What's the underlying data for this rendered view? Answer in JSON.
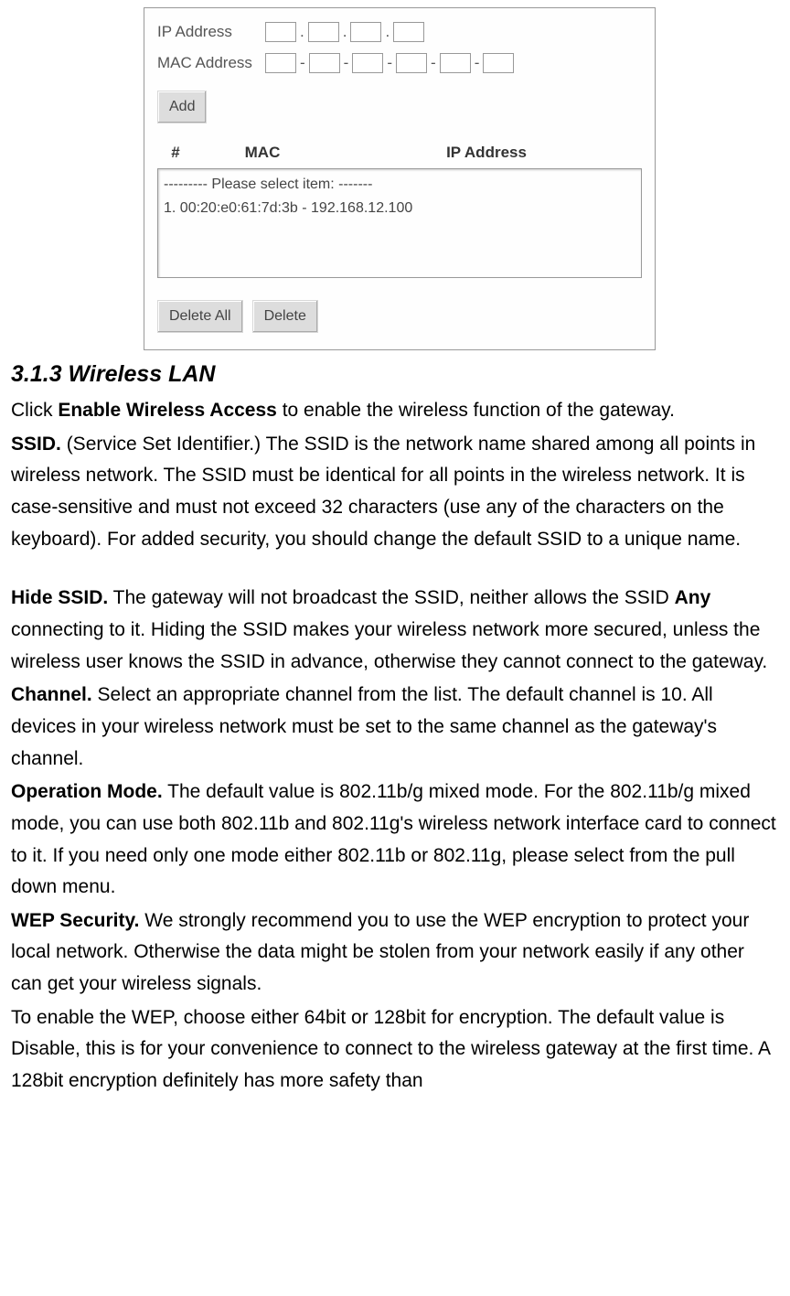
{
  "figure": {
    "ip_label": "IP Address",
    "mac_label": "MAC Address",
    "add_btn": "Add",
    "table": {
      "h1": "#",
      "h2": "MAC",
      "h3": "IP Address"
    },
    "list": {
      "l1": "--------- Please select item: -------",
      "l2": "1. 00:20:e0:61:7d:3b - 192.168.12.100"
    },
    "del_all": "Delete All",
    "del": "Delete"
  },
  "heading": "3.1.3 Wireless LAN",
  "p1": {
    "a": "Click ",
    "b": "Enable Wireless Access",
    "c": " to enable the wireless function of the gateway."
  },
  "p2": {
    "b": "SSID.",
    "t": " (Service Set Identifier.) The SSID is the network name shared among all points in wireless network. The SSID must be identical for all points in the wireless network. It is case-sensitive and must not exceed 32 characters (use any of the characters on the keyboard). For added security, you should change the default SSID to a unique name."
  },
  "p3": {
    "b1": "Hide SSID.",
    "t1": " The gateway will not broadcast the SSID, neither allows the SSID ",
    "b2": "Any",
    "t2": " connecting to it. Hiding the SSID makes your wireless network more secured, unless the wireless user knows the SSID in advance, otherwise they cannot connect to the gateway."
  },
  "p4": {
    "b": "Channel.",
    "t": " Select an appropriate channel from the list. The default channel is 10. All devices in your wireless network must be set to the same channel as the gateway's channel."
  },
  "p5": {
    "b": "Operation Mode.",
    "t": " The default value is 802.11b/g mixed mode. For the 802.11b/g mixed mode, you can use both 802.11b and 802.11g's wireless network interface card to connect to it. If you need only one mode either 802.11b or 802.11g, please select from the pull down menu."
  },
  "p6": {
    "b": "WEP Security.",
    "t": " We strongly recommend you to use the WEP encryption to protect your local network. Otherwise the data might be stolen from your network easily if any other can get your wireless signals."
  },
  "p7": "To enable the WEP, choose either 64bit or 128bit for encryption. The default value is Disable, this is for your convenience to connect to the wireless gateway at the first time. A 128bit encryption definitely has more safety than"
}
